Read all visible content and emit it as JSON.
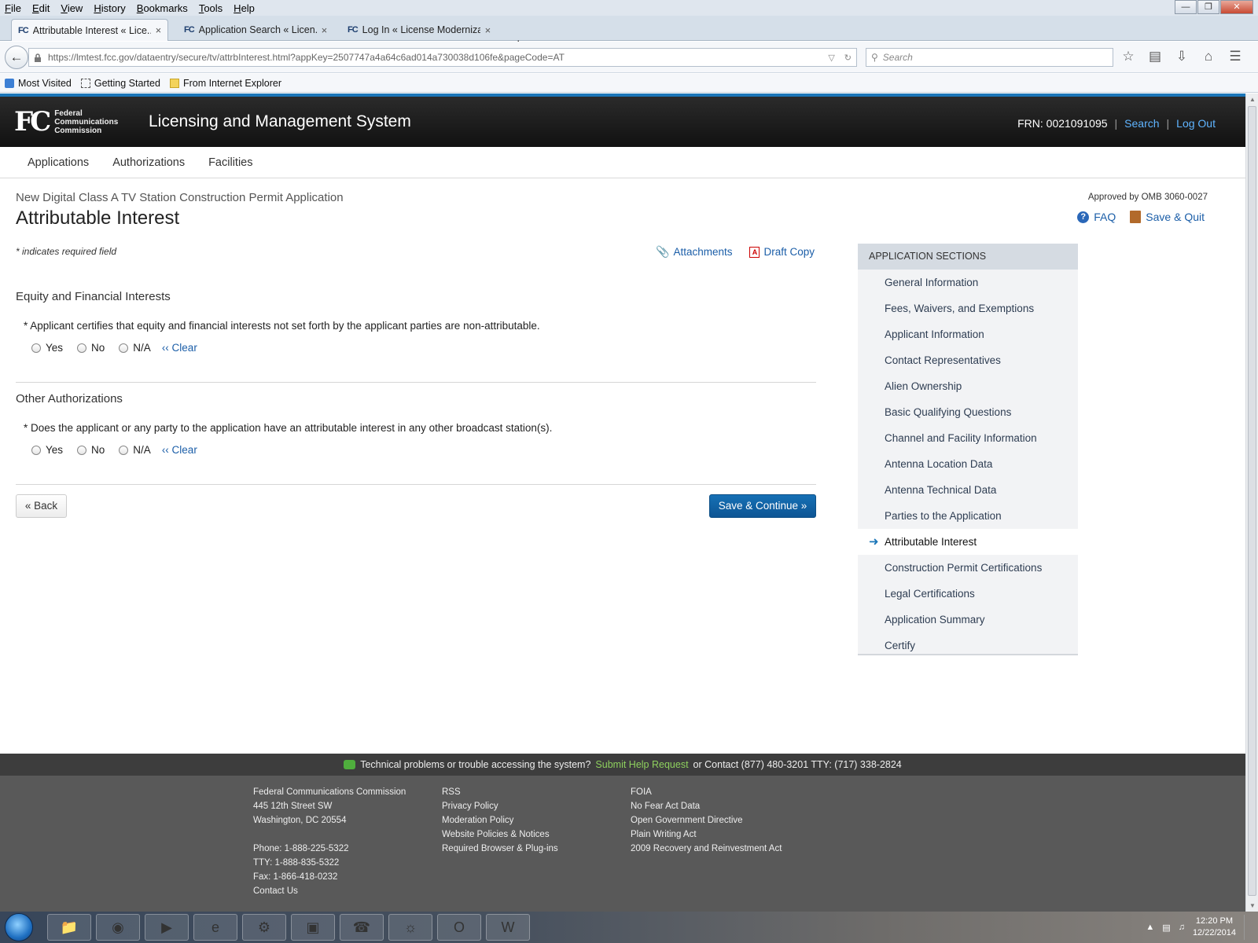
{
  "browser": {
    "menu": [
      "File",
      "Edit",
      "View",
      "History",
      "Bookmarks",
      "Tools",
      "Help"
    ],
    "tabs": [
      {
        "favicon": "FC",
        "title": "Attributable Interest « Lice...",
        "close": "×"
      },
      {
        "favicon": "FC",
        "title": "Application Search « Licen...",
        "close": "×"
      },
      {
        "favicon": "FC",
        "title": "Log In « License Moderniza...",
        "close": "×"
      }
    ],
    "new_tab": "+",
    "url": "https://lmtest.fcc.gov/dataentry/secure/tv/attrbInterest.html?appKey=2507747a4a64c6ad014a730038d106fe&pageCode=AT",
    "search_placeholder": "Search",
    "bookmarks": [
      "Most Visited",
      "Getting Started",
      "From Internet Explorer"
    ]
  },
  "header": {
    "logo_mark": "FC",
    "logo_lines": [
      "Federal",
      "Communications",
      "Commission"
    ],
    "site_title": "Licensing and Management System",
    "frn": "FRN: 0021091095",
    "sep": "|",
    "search": "Search",
    "logout": "Log Out"
  },
  "nav": [
    "Applications",
    "Authorizations",
    "Facilities"
  ],
  "page": {
    "subtitle": "New Digital Class A TV Station Construction Permit Application",
    "title": "Attributable Interest",
    "omb": "Approved by OMB 3060-0027",
    "faq": "FAQ",
    "save_quit": "Save & Quit",
    "required_note": "* indicates required field",
    "attachments": "Attachments",
    "draft_copy": "Draft Copy"
  },
  "form": {
    "sections": [
      {
        "title": "Equity and Financial Interests",
        "question": "* Applicant certifies that equity and financial interests not set forth by the applicant parties are non-attributable."
      },
      {
        "title": "Other Authorizations",
        "question": "* Does the applicant or any party to the application have an attributable interest in any other broadcast station(s)."
      }
    ],
    "options": [
      "Yes",
      "No",
      "N/A"
    ],
    "clear": "‹‹ Clear",
    "back": "« Back",
    "save_continue": "Save & Continue »"
  },
  "app_sections": {
    "header": "APPLICATION SECTIONS",
    "items": [
      "General Information",
      "Fees, Waivers, and Exemptions",
      "Applicant Information",
      "Contact Representatives",
      "Alien Ownership",
      "Basic Qualifying Questions",
      "Channel and Facility Information",
      "Antenna Location Data",
      "Antenna Technical Data",
      "Parties to the Application",
      "Attributable Interest",
      "Construction Permit Certifications",
      "Legal Certifications",
      "Application Summary",
      "Certify"
    ],
    "current": "Attributable Interest"
  },
  "footer": {
    "help_prefix": "Technical problems or trouble accessing the system?",
    "help_link": "Submit Help Request",
    "help_suffix": "or Contact (877) 480-3201 TTY: (717) 338-2824",
    "col1": [
      "Federal Communications Commission",
      "445 12th Street SW",
      "Washington, DC 20554",
      "",
      "Phone: 1-888-225-5322",
      "TTY: 1-888-835-5322",
      "Fax: 1-866-418-0232",
      "Contact Us"
    ],
    "col2": [
      "RSS",
      "Privacy Policy",
      "Moderation Policy",
      "Website Policies & Notices",
      "Required Browser & Plug-ins"
    ],
    "col3": [
      "FOIA",
      "No Fear Act Data",
      "Open Government Directive",
      "Plain Writing Act",
      "2009 Recovery and Reinvestment Act"
    ]
  },
  "taskbar": {
    "time": "12:20 PM",
    "date": "12/22/2014"
  }
}
